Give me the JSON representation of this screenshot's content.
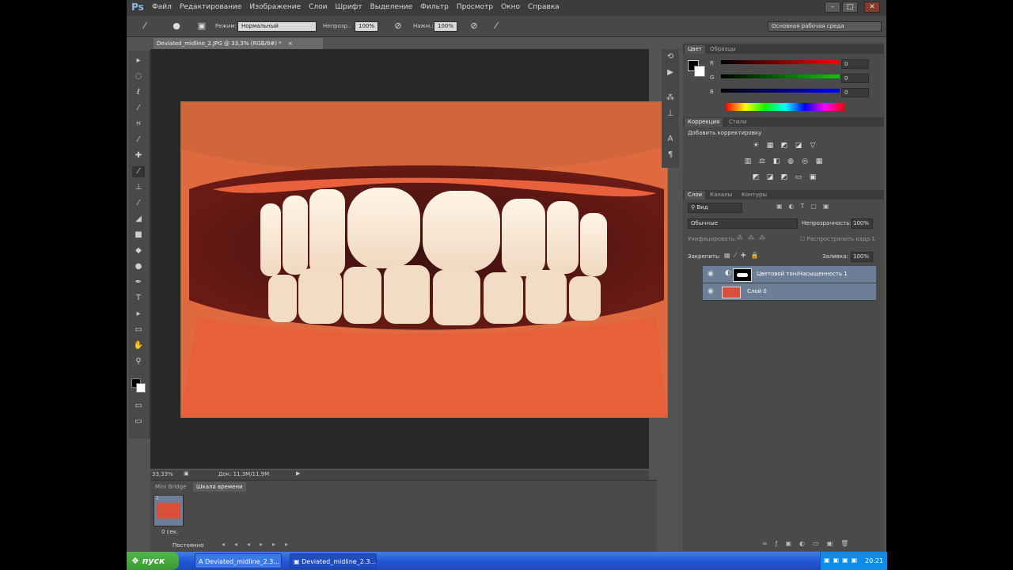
{
  "app": {
    "logo": "Ps",
    "menu": [
      "Файл",
      "Редактирование",
      "Изображение",
      "Слои",
      "Шрифт",
      "Выделение",
      "Фильтр",
      "Просмотр",
      "Окно",
      "Справка"
    ],
    "window_buttons": [
      "–",
      "□",
      "✕"
    ]
  },
  "options": {
    "mode_label": "Режим:",
    "mode_value": "Нормальный",
    "opacity_label": "Непрозр.:",
    "opacity_value": "100%",
    "press_label": "Нажм.:",
    "press_value": "100%",
    "workspace": "Основная рабочая среда"
  },
  "document": {
    "tab_title": "Deviated_midline_2.JPG @ 33,3% (RGB/8#) *",
    "zoom": "33,33%",
    "doc_info": "Док: 11,3M/11,9M"
  },
  "timeline": {
    "tabs": [
      "Mini Bridge",
      "Шкала времени"
    ],
    "frame_number": "1",
    "frame_delay": "0 сек.",
    "loop": "Постоянно"
  },
  "color_panel": {
    "tabs": [
      "Цвет",
      "Образцы"
    ],
    "channels": [
      {
        "label": "R",
        "value": "0"
      },
      {
        "label": "G",
        "value": "0"
      },
      {
        "label": "B",
        "value": "0"
      }
    ]
  },
  "adjustments_panel": {
    "tabs": [
      "Коррекция",
      "Стили"
    ],
    "heading": "Добавить корректировку"
  },
  "layers_panel": {
    "tabs": [
      "Слои",
      "Каналы",
      "Контуры"
    ],
    "filter_kind": "Вид",
    "blend_mode": "Обычные",
    "opacity_label": "Непрозрачность:",
    "opacity_value": "100%",
    "unify_label": "Унифицировать:",
    "propagate_label": "Распространить кадр 1",
    "lock_label": "Закрепить:",
    "fill_label": "Заливка:",
    "fill_value": "100%",
    "layers": [
      {
        "name": "Цветовой тон/Насыщенность 1",
        "type": "adjustment"
      },
      {
        "name": "Слой 0",
        "type": "pixel"
      }
    ]
  },
  "taskbar": {
    "start_label": "пуск",
    "items": [
      "Deviated_midline_2.3...",
      "Deviated_midline_2.3..."
    ],
    "clock": "20:21"
  },
  "colors": {
    "photoshop_bg": "#535353",
    "layer_selected": "#6c7f97",
    "taskbar_blue": "#2457d5",
    "start_green": "#3a9b34"
  }
}
